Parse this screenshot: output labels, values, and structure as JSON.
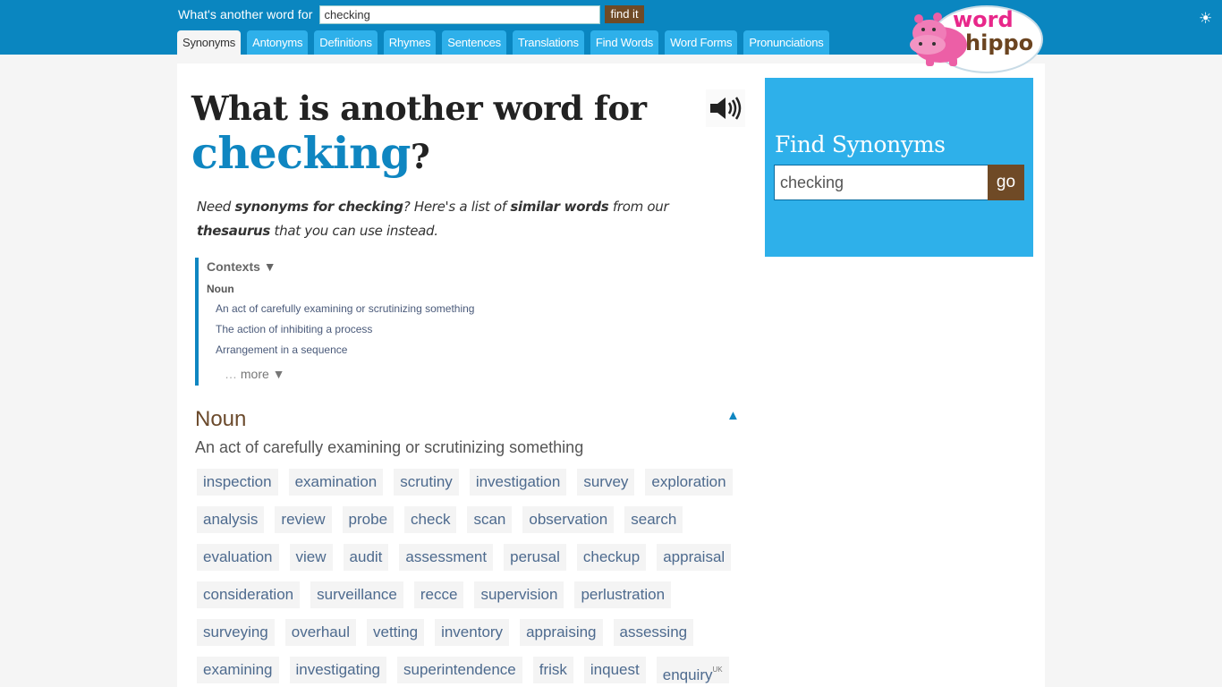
{
  "header": {
    "search_label": "What's another word for",
    "search_value": "checking",
    "find_button": "find it",
    "tabs": [
      {
        "label": "Synonyms",
        "active": true
      },
      {
        "label": "Antonyms",
        "active": false
      },
      {
        "label": "Definitions",
        "active": false
      },
      {
        "label": "Rhymes",
        "active": false
      },
      {
        "label": "Sentences",
        "active": false
      },
      {
        "label": "Translations",
        "active": false
      },
      {
        "label": "Find Words",
        "active": false
      },
      {
        "label": "Word Forms",
        "active": false
      },
      {
        "label": "Pronunciations",
        "active": false
      }
    ],
    "logo": {
      "line1": "word",
      "line2": "hippo"
    },
    "theme_icon": "sun-icon"
  },
  "main": {
    "title_prefix": "What is another word for",
    "word": "checking",
    "question_mark": "?",
    "speaker_icon": "speaker-icon",
    "intro": {
      "p1": "Need ",
      "b1": "synonyms for checking",
      "p2": "? Here's a list of ",
      "b2": "similar words",
      "p3": " from our ",
      "b3": "thesaurus",
      "p4": " that you can use instead."
    },
    "contexts": {
      "heading": "Contexts ▼",
      "part_of_speech": "Noun",
      "items": [
        "An act of carefully examining or scrutinizing something",
        "The action of inhibiting a process",
        "Arrangement in a sequence"
      ],
      "more_dots": "…",
      "more_label": "more ▼"
    },
    "section": {
      "part_of_speech": "Noun",
      "collapse_icon": "▲",
      "definition": "An act of carefully examining or scrutinizing something",
      "synonym_rows": [
        [
          "inspection",
          "examination",
          "scrutiny",
          "investigation",
          "survey",
          "exploration"
        ],
        [
          "analysis",
          "review",
          "probe",
          "check",
          "scan",
          "observation",
          "search"
        ],
        [
          "evaluation",
          "view",
          "audit",
          "assessment",
          "perusal",
          "checkup",
          "appraisal"
        ],
        [
          "consideration",
          "surveillance",
          "recce",
          "supervision",
          "perlustration"
        ],
        [
          "surveying",
          "overhaul",
          "vetting",
          "inventory",
          "appraising",
          "assessing"
        ],
        [
          "examining",
          "investigating",
          "superintendence",
          "frisk",
          "inquest",
          "enquiry"
        ]
      ],
      "enquiry_tag": "UK"
    }
  },
  "sidebar": {
    "title": "Find Synonyms",
    "input_value": "checking",
    "go_button": "go"
  },
  "colors": {
    "header_blue": "#0a86c0",
    "tab_blue": "#2eb0ea",
    "accent_word": "#0f86c1",
    "brown_button": "#6f4a26",
    "noun_brown": "#6b4a2c",
    "synonym_text": "#4d6a8e"
  }
}
